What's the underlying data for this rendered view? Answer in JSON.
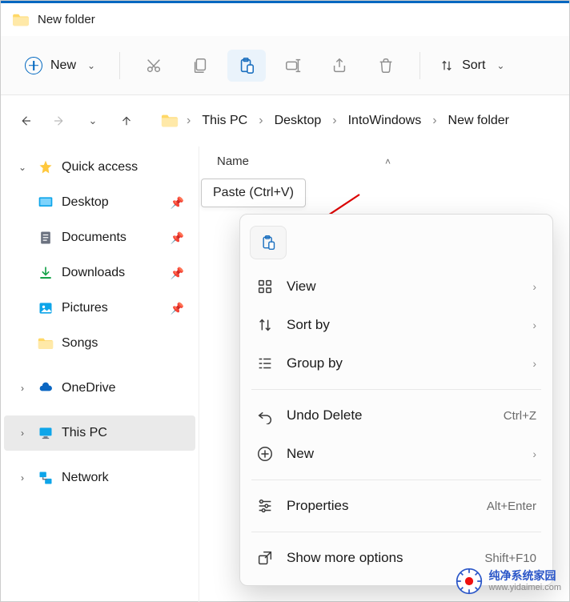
{
  "window": {
    "title": "New folder"
  },
  "toolbar": {
    "new_label": "New",
    "sort_label": "Sort"
  },
  "breadcrumbs": [
    "This PC",
    "Desktop",
    "IntoWindows",
    "New folder"
  ],
  "sidebar": {
    "quick_access": "Quick access",
    "items": [
      {
        "label": "Desktop"
      },
      {
        "label": "Documents"
      },
      {
        "label": "Downloads"
      },
      {
        "label": "Pictures"
      },
      {
        "label": "Songs"
      }
    ],
    "onedrive": "OneDrive",
    "this_pc": "This PC",
    "network": "Network"
  },
  "columns": {
    "name": "Name"
  },
  "tooltip": {
    "paste": "Paste (Ctrl+V)"
  },
  "context_menu": {
    "view": "View",
    "sort_by": "Sort by",
    "group_by": "Group by",
    "undo_delete": "Undo Delete",
    "undo_shortcut": "Ctrl+Z",
    "new": "New",
    "properties": "Properties",
    "properties_shortcut": "Alt+Enter",
    "more_options": "Show more options",
    "more_shortcut": "Shift+F10"
  },
  "watermark": {
    "cn": "纯净系统家园",
    "url": "www.yidaimei.com"
  }
}
